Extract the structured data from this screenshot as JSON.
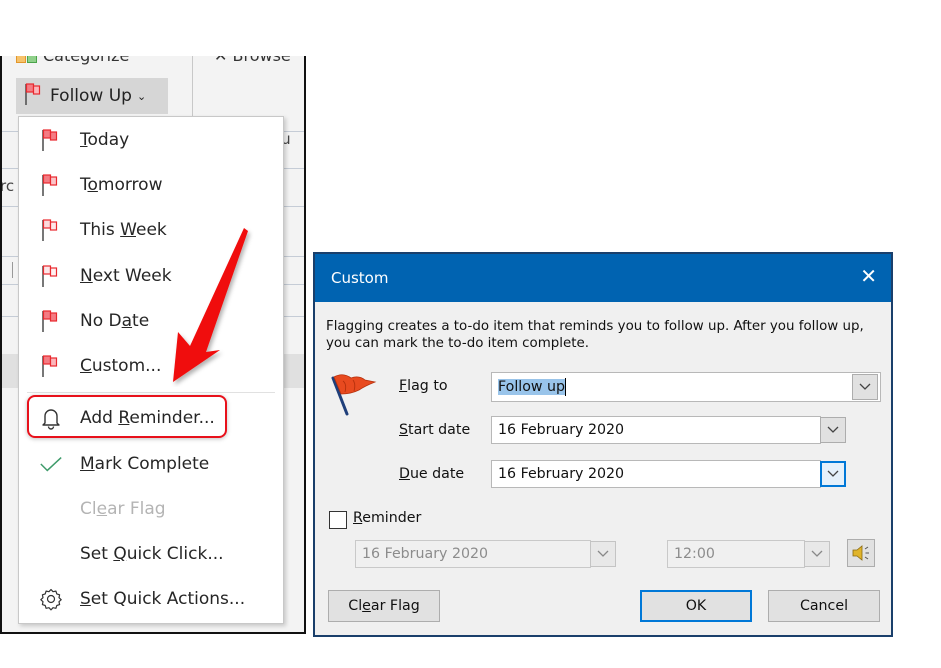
{
  "background_app": {
    "ribbon_partial_label_left": "Categorize",
    "ribbon_partial_label_right": "Browse",
    "follow_up_button": "Follow Up",
    "partial_text_right": "ou",
    "partial_text_left": "rc"
  },
  "follow_up_menu": {
    "items": [
      {
        "label": "Today",
        "accel_index": 0,
        "icon": "flag-today-icon"
      },
      {
        "label": "Tomorrow",
        "accel_index": 1,
        "icon": "flag-tomorrow-icon"
      },
      {
        "label": "This Week",
        "accel_index": 5,
        "icon": "flag-this-week-icon"
      },
      {
        "label": "Next Week",
        "accel_index": 0,
        "icon": "flag-next-week-icon"
      },
      {
        "label": "No Date",
        "accel_index": 4,
        "icon": "flag-no-date-icon"
      },
      {
        "label": "Custom...",
        "accel_index": 0,
        "icon": "flag-custom-icon"
      },
      {
        "label": "Add Reminder...",
        "accel_index": 4,
        "icon": "bell-icon"
      },
      {
        "label": "Mark Complete",
        "accel_index": 0,
        "icon": "checkmark-icon"
      },
      {
        "label": "Clear Flag",
        "accel_index": 2,
        "icon": "",
        "disabled": true
      },
      {
        "label": "Set Quick Click...",
        "accel_index": 4,
        "icon": ""
      },
      {
        "label": "Set Quick Actions...",
        "accel_index": 0,
        "icon": "gear-icon"
      }
    ],
    "highlighted_item": "Add Reminder..."
  },
  "dialog": {
    "title": "Custom",
    "close_icon": "close-icon",
    "description": "Flagging creates a to-do item that reminds you to follow up. After you follow up, you can mark the to-do item complete.",
    "flag_to": {
      "label": "Flag to",
      "accel": "F",
      "value": "Follow up"
    },
    "start_date": {
      "label": "Start date",
      "accel": "S",
      "value": "16 February 2020"
    },
    "due_date": {
      "label": "Due date",
      "accel": "D",
      "value": "16 February 2020"
    },
    "reminder": {
      "label": "Reminder",
      "accel": "R",
      "checked": false,
      "date": "16 February 2020",
      "time": "12:00"
    },
    "buttons": {
      "clear_flag": "Clear Flag",
      "ok": "OK",
      "cancel": "Cancel"
    }
  },
  "colors": {
    "title_bar": "#0063b1",
    "annotation_red": "#e8111b",
    "flag_red": "#e8282e",
    "focus_blue": "#0078d7"
  }
}
